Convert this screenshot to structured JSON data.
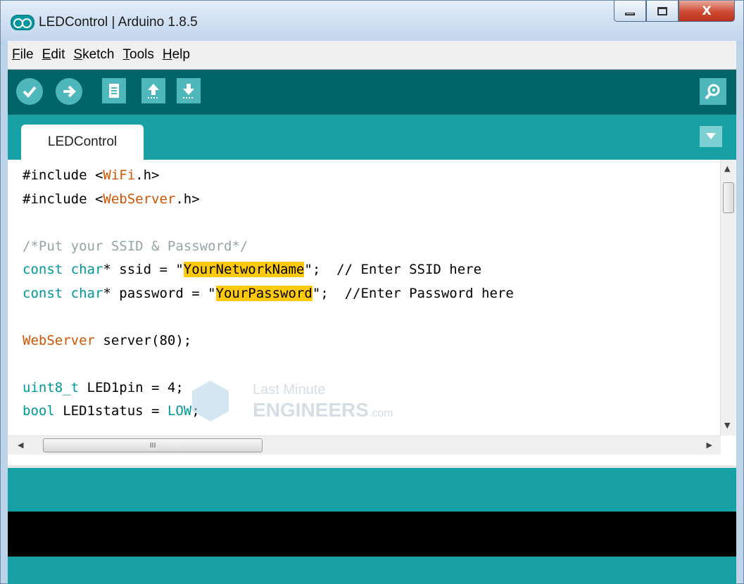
{
  "window": {
    "title": "LEDControl | Arduino 1.8.5",
    "close_glyph": "X"
  },
  "menu": {
    "items": [
      {
        "accel": "F",
        "rest": "ile"
      },
      {
        "accel": "E",
        "rest": "dit"
      },
      {
        "accel": "S",
        "rest": "ketch"
      },
      {
        "accel": "T",
        "rest": "ools"
      },
      {
        "accel": "H",
        "rest": "elp"
      }
    ]
  },
  "toolbar": {
    "buttons": [
      "verify-icon",
      "upload-icon",
      "new-icon",
      "open-icon",
      "save-icon"
    ],
    "serial_monitor": "serial-monitor-icon"
  },
  "tabs": [
    {
      "label": "LEDControl"
    }
  ],
  "editor": {
    "lines": [
      {
        "a": "#include <",
        "b": "WiFi",
        "c": ".h>"
      },
      {
        "a": "#include <",
        "b": "WebServer",
        "c": ".h>"
      },
      {
        "blank": ""
      },
      {
        "comment": "/*Put your SSID & Password*/"
      },
      {
        "kw": "const char",
        "mid": "* ssid = \"",
        "hl": "YourNetworkName",
        "end": "\";",
        "cm": "  // Enter SSID here"
      },
      {
        "kw": "const char",
        "mid": "* password = \"",
        "hl": "YourPassword",
        "end": "\";",
        "cm": "  //Enter Password here"
      },
      {
        "blank": ""
      },
      {
        "type": "WebServer",
        "rest": " server(80);"
      },
      {
        "blank": ""
      },
      {
        "kw": "uint8_t",
        "rest": " LED1pin = 4;"
      },
      {
        "kw": "bool",
        "rest": " LED1status = ",
        "const": "LOW",
        "end": ";"
      }
    ],
    "hscroll_grip": "III"
  },
  "watermark": {
    "line1": "Last Minute",
    "line2": "ENGINEERS",
    "domain": ".com"
  },
  "colors": {
    "toolbar": "#006468",
    "tabbar": "#17a1a5",
    "keyword": "#00979c",
    "library": "#d35400",
    "comment": "#95a5a6",
    "highlight": "#ffc90e"
  }
}
